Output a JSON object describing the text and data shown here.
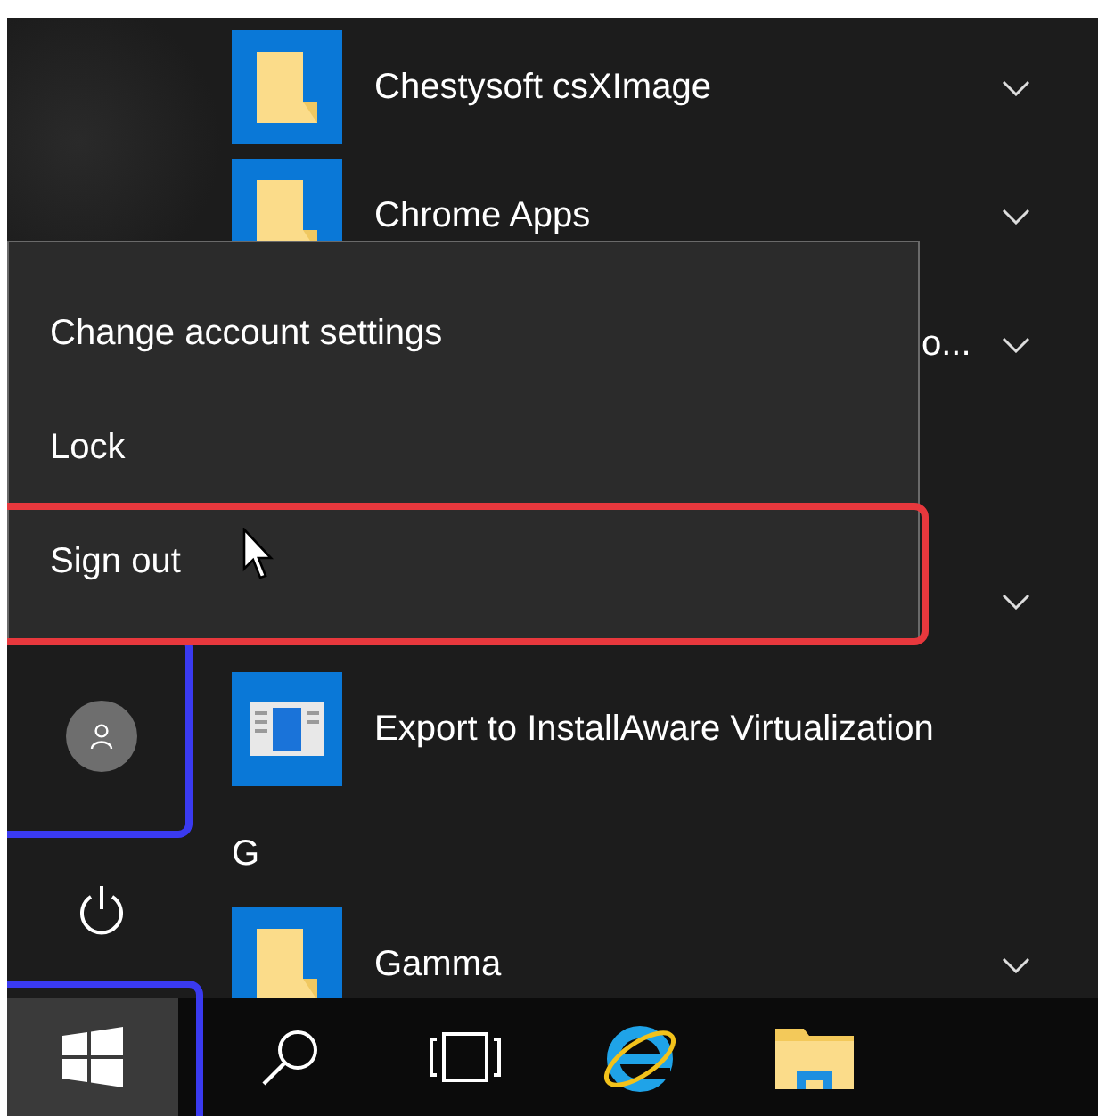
{
  "app_list": {
    "rows": [
      {
        "kind": "folder",
        "name": "Chestysoft csXImage",
        "expandable": true
      },
      {
        "kind": "folder",
        "name": "Chrome Apps",
        "expandable": true
      },
      {
        "kind": "covered",
        "name": "o...",
        "expandable": true
      },
      {
        "kind": "covered",
        "expandable": true
      },
      {
        "kind": "app",
        "name": "Export to InstallAware Virtualization",
        "expandable": false
      },
      {
        "kind": "letter",
        "name": "G"
      },
      {
        "kind": "folder",
        "name": "Gamma",
        "expandable": true
      }
    ]
  },
  "account_menu": {
    "items": [
      {
        "label": "Change account settings",
        "outlined": false
      },
      {
        "label": "Lock",
        "outlined": false
      },
      {
        "label": "Sign out",
        "outlined": true
      }
    ]
  },
  "rail": {
    "account_outlined": true
  },
  "taskbar": {
    "start_outlined": true
  }
}
